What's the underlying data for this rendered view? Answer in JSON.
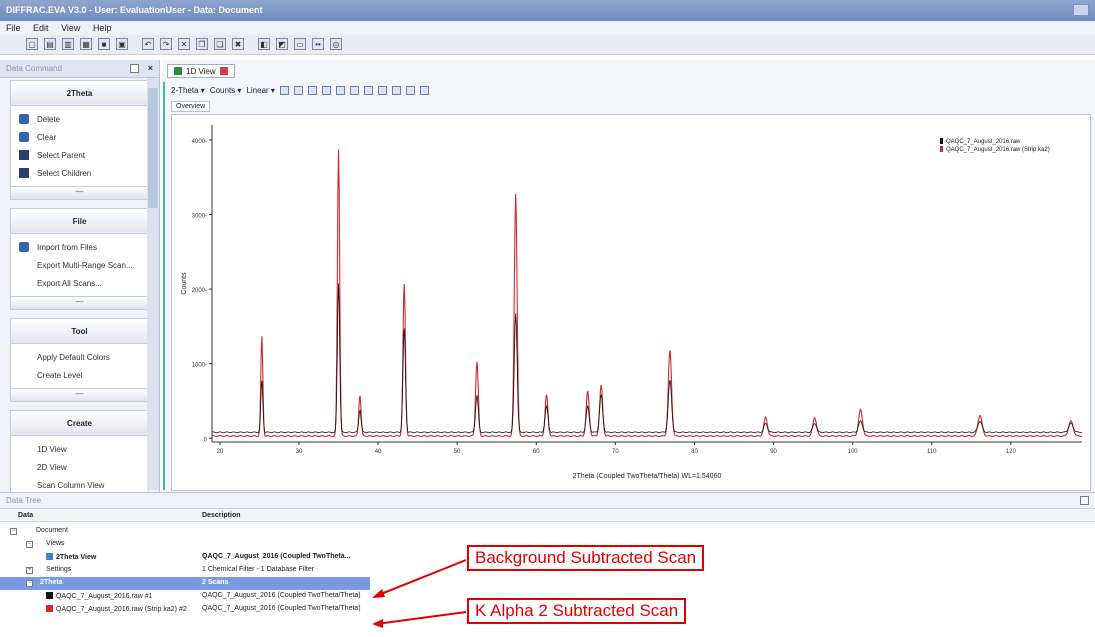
{
  "window": {
    "title": "DIFFRAC.EVA V3.0 - User: EvaluationUser - Data: Document"
  },
  "menu": [
    "File",
    "Edit",
    "View",
    "Help"
  ],
  "command_panel": {
    "header": "Data Command",
    "sections": [
      {
        "title": "2Theta",
        "items": [
          "Delete",
          "Clear",
          "Select Parent",
          "Select Children"
        ]
      },
      {
        "title": "File",
        "items": [
          "Import from Files",
          "Export Multi-Range Scan...",
          "Export All Scans..."
        ]
      },
      {
        "title": "Tool",
        "items": [
          "Apply Default Colors",
          "Create Level"
        ]
      },
      {
        "title": "Create",
        "items": [
          "1D View",
          "2D View",
          "Scan Column View"
        ]
      }
    ]
  },
  "document": {
    "tab_label": "1D View",
    "toolbar": {
      "xunit": "2-Theta",
      "yunit": "Counts",
      "scale": "Linear"
    },
    "overview_tab": "Overview"
  },
  "chart_data": {
    "type": "line",
    "xlabel": "2Theta (Coupled TwoTheta/Theta) WL=1.54060",
    "ylabel": "Counts",
    "xlim": [
      19,
      129
    ],
    "ylim": [
      -500,
      42000
    ],
    "xticks": [
      20,
      30,
      40,
      50,
      60,
      70,
      80,
      90,
      100,
      110,
      120
    ],
    "yticks": [
      0,
      10000,
      20000,
      30000,
      40000
    ],
    "ytick_labels": [
      "0",
      "1000-",
      "2000-",
      "3000-",
      "4000-"
    ],
    "grid": false,
    "legend_position": "top-right",
    "series": [
      {
        "name": "QAQC_7_August_2016.raw",
        "color": "#111111",
        "peaks": [
          [
            25.3,
            7000
          ],
          [
            35.0,
            20000
          ],
          [
            37.7,
            3000
          ],
          [
            43.3,
            14000
          ],
          [
            52.5,
            5000
          ],
          [
            57.4,
            16000
          ],
          [
            61.3,
            3500
          ],
          [
            66.5,
            3500
          ],
          [
            68.2,
            5000
          ],
          [
            76.9,
            7000
          ],
          [
            89.0,
            1200
          ],
          [
            95.2,
            1200
          ],
          [
            101.0,
            1500
          ],
          [
            116.1,
            1500
          ],
          [
            127.6,
            1200
          ]
        ],
        "baseline": 800
      },
      {
        "name": "QAQC_7_August_2016.raw (Strip ka2)",
        "color": "#d22a2a",
        "peaks": [
          [
            25.3,
            13500
          ],
          [
            35.0,
            38500
          ],
          [
            37.7,
            5500
          ],
          [
            43.3,
            20500
          ],
          [
            52.5,
            10000
          ],
          [
            57.4,
            32500
          ],
          [
            61.3,
            5500
          ],
          [
            66.5,
            6000
          ],
          [
            68.2,
            6800
          ],
          [
            76.9,
            11500
          ],
          [
            89.0,
            2500
          ],
          [
            95.2,
            2500
          ],
          [
            101.0,
            3500
          ],
          [
            116.1,
            2800
          ],
          [
            127.6,
            2000
          ]
        ],
        "baseline": 300
      }
    ]
  },
  "data_tree": {
    "header": "Data Tree",
    "columns": {
      "data": "Data",
      "description": "Description"
    },
    "rows": [
      {
        "name": "Document",
        "description": ""
      },
      {
        "name": "Views",
        "description": ""
      },
      {
        "name": "2Theta View",
        "description": "QAQC_7_August_2016 (Coupled TwoTheta..."
      },
      {
        "name": "Settings",
        "description": "1 Chemical Filter - 1 Database Filter"
      },
      {
        "name": "2Theta",
        "description": "2 Scans"
      },
      {
        "name": "QAQC_7_August_2016.raw #1",
        "description": "QAQC_7_August_2016 (Coupled TwoTheta/Theta)"
      },
      {
        "name": "QAQC_7_August_2016.raw (Strip ka2) #2",
        "description": "QAQC_7_August_2016 (Coupled TwoTheta/Theta)"
      }
    ]
  },
  "annotations": {
    "callout_background": "Background Subtracted Scan",
    "callout_kalpha": "K Alpha 2 Subtracted Scan",
    "color": "#e00000"
  }
}
